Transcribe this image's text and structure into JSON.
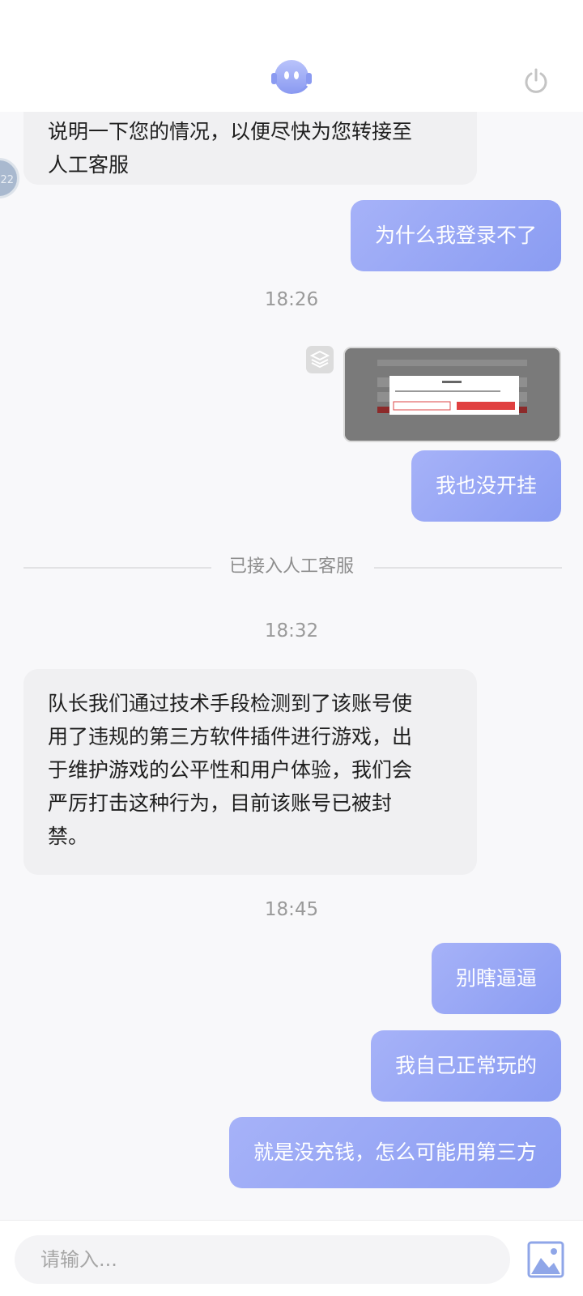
{
  "header": {
    "bot_icon": "headset-robot-icon",
    "power_icon": "power-icon"
  },
  "messages": {
    "m1_line1": "说明一下您的情况，以便尽快为您转接至",
    "m1_line2": "人工客服",
    "m1_avatar_text": "22",
    "m2": "为什么我登录不了",
    "ts1": "18:26",
    "m3_image": "screenshot-image",
    "m4": "我也没开挂",
    "divider": "已接入人工客服",
    "ts2": "18:32",
    "m5_line1": "队长我们通过技术手段检测到了该账号使",
    "m5_line2": "用了违规的第三方软件插件进行游戏，出",
    "m5_line3": "于维护游戏的公平性和用户体验，我们会",
    "m5_line4": "严厉打击这种行为，目前该账号已被封",
    "m5_line5": "禁。",
    "ts3": "18:45",
    "m6": "别瞎逼逼",
    "m7": "我自己正常玩的",
    "m8": "就是没充钱，怎么可能用第三方"
  },
  "input": {
    "placeholder": "请输入...",
    "image_icon": "image-icon"
  },
  "colors": {
    "bubble_right": "#8a9cf2",
    "bubble_left": "#f0f0f2",
    "timestamp": "#9a9a9a"
  }
}
